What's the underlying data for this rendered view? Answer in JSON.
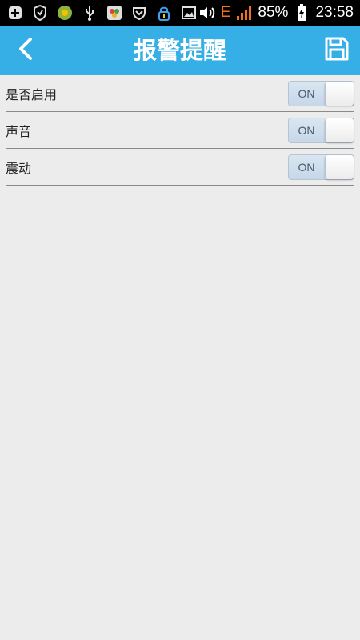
{
  "status_bar": {
    "battery": "85%",
    "time": "23:58",
    "network": "E",
    "icons": [
      "notification-plus-icon",
      "shield-icon",
      "app-icon",
      "usb-icon",
      "gallery-icon",
      "vpn-icon",
      "lock-icon",
      "image-icon",
      "volume-icon",
      "signal-icon",
      "battery-charging-icon"
    ]
  },
  "header": {
    "title": "报警提醒",
    "back_icon": "chevron-left-icon",
    "save_icon": "save-icon"
  },
  "settings": [
    {
      "label": "是否启用",
      "state": "ON"
    },
    {
      "label": "声音",
      "state": "ON"
    },
    {
      "label": "震动",
      "state": "ON"
    }
  ],
  "colors": {
    "header_bg": "#36aee6",
    "page_bg": "#ececec",
    "status_bg": "#000000",
    "network_type": "#f07020"
  }
}
